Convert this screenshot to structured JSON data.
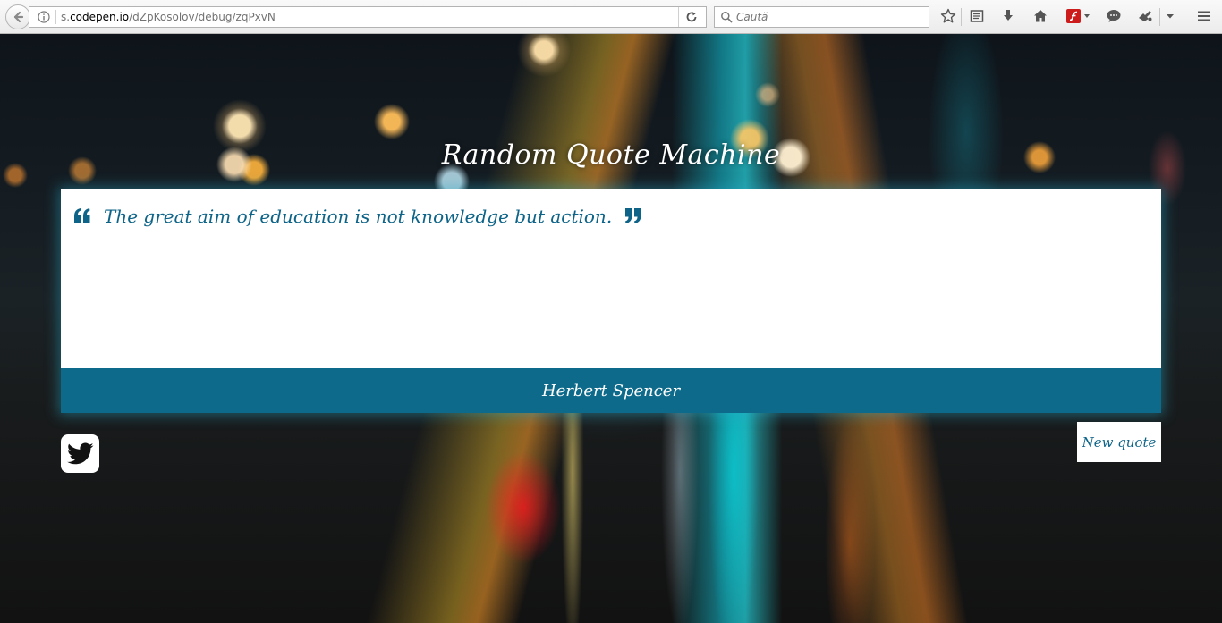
{
  "browser": {
    "url_prefix": "s.",
    "url_host": "codepen.io",
    "url_path": "/dZpKosolov/debug/zqPxvN",
    "search_placeholder": "Caută",
    "icons": [
      "back-icon",
      "info-icon",
      "reload-icon",
      "search-icon",
      "bookmark-star-icon",
      "reading-list-icon",
      "download-icon",
      "home-icon",
      "flash-icon",
      "chat-icon",
      "extension-icon",
      "menu-icon"
    ]
  },
  "app": {
    "title": "Random Quote Machine",
    "quote_text": "The great aim of education is not knowledge but action.",
    "author": "Herbert Spencer",
    "new_quote_label": "New quote",
    "accent_color": "#0d6a8b"
  }
}
